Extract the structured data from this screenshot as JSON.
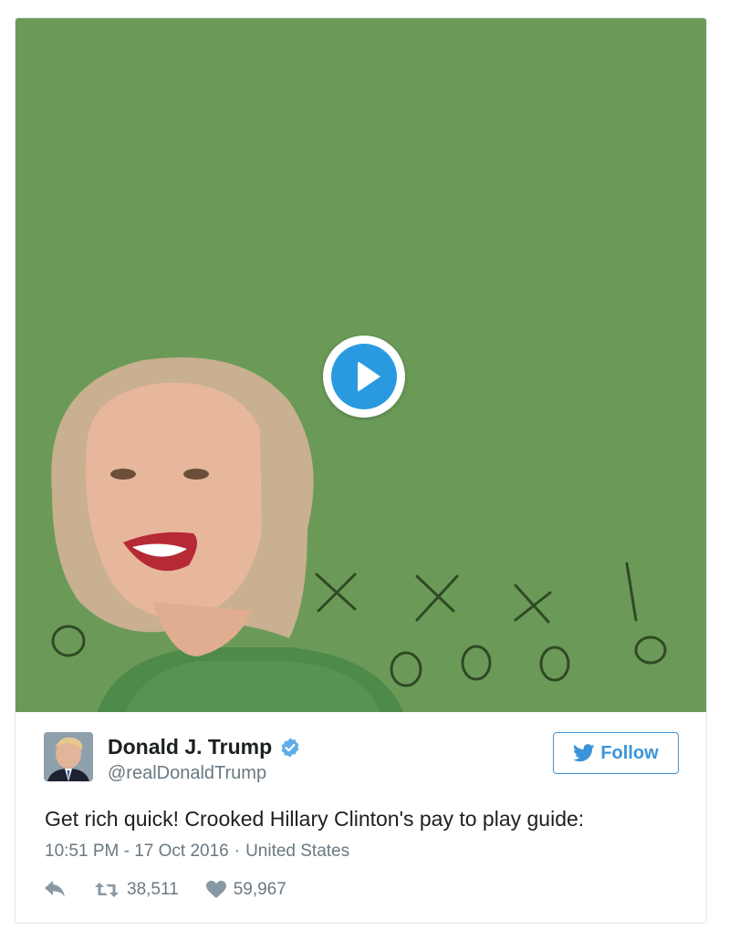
{
  "media": {
    "play_icon": "play-icon",
    "background_color": "#6b9a58",
    "play_color": "#2a9ae0"
  },
  "author": {
    "name": "Donald J. Trump",
    "handle": "@realDonaldTrump",
    "verified_icon": "verified-badge-icon"
  },
  "follow_button": {
    "label": "Follow",
    "icon": "twitter-bird-icon",
    "color": "#3b94d9"
  },
  "tweet": {
    "text": "Get rich quick! Crooked Hillary Clinton's pay to play guide:",
    "time": "10:51 PM - 17 Oct 2016",
    "separator": "·",
    "location": "United States"
  },
  "actions": {
    "reply_icon": "reply-icon",
    "retweet_icon": "retweet-icon",
    "retweet_count": "38,511",
    "like_icon": "heart-icon",
    "like_count": "59,967"
  }
}
